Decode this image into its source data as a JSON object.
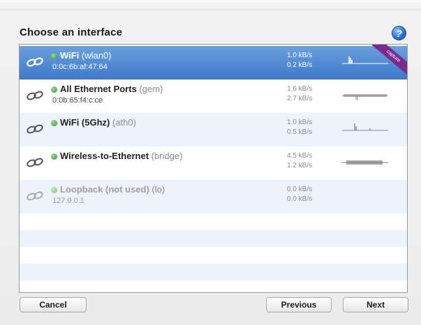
{
  "dialog": {
    "title": "Choose an interface",
    "help_icon": "help-icon",
    "help_glyph": "?"
  },
  "interfaces": [
    {
      "name": "WiFi",
      "tag": "(wlan0)",
      "address": "0:0c:6b:af:47:64",
      "rate_in": "1.0 kB/s",
      "rate_out": "0.2 kB/s",
      "selected": true,
      "ribbon": "capture"
    },
    {
      "name": "All Ethernet Ports",
      "tag": "(gem)",
      "address": "0:0b:65:f4:c:ce",
      "rate_in": "1.6 kB/s",
      "rate_out": "2.7 kB/s"
    },
    {
      "name": "WiFi (5Ghz)",
      "tag": "(ath0)",
      "address": "",
      "rate_in": "1.0 kB/s",
      "rate_out": "0.5 kB/s"
    },
    {
      "name": "Wireless-to-Ethernet",
      "tag": "(bridge)",
      "address": "",
      "rate_in": "4.5 kB/s",
      "rate_out": "1.2 kB/s"
    },
    {
      "name": "Loopback (not used)",
      "tag": "(lo)",
      "address": "127.0.0.1",
      "rate_in": "0.0 kB/s",
      "rate_out": "0.0 kB/s",
      "disabled": true
    }
  ],
  "buttons": {
    "cancel": "Cancel",
    "previous": "Previous",
    "next": "Next"
  },
  "colors": {
    "selection": "#4a84d0",
    "alt_row": "#edf3fc",
    "status_dot": "#3aa33a",
    "ribbon": "#7a2c8c"
  }
}
